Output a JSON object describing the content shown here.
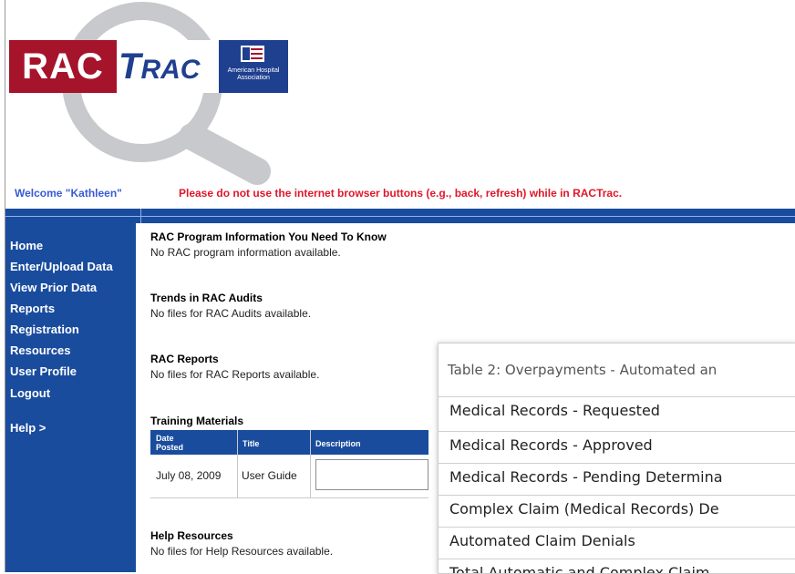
{
  "header": {
    "logo": {
      "rac": "RAC",
      "trac_first": "T",
      "trac_rest": "RAC",
      "aha_text": "American Hospital Association"
    },
    "welcome": "Welcome \"Kathleen\"",
    "warning": "Please do not use the internet browser buttons (e.g., back, refresh) while in RACTrac."
  },
  "sidebar": {
    "items": [
      {
        "label": "Home"
      },
      {
        "label": "Enter/Upload Data"
      },
      {
        "label": "View Prior Data"
      },
      {
        "label": "Reports"
      },
      {
        "label": "Registration"
      },
      {
        "label": "Resources"
      },
      {
        "label": "User Profile"
      },
      {
        "label": "Logout"
      },
      {
        "label": "Help >"
      }
    ]
  },
  "main": {
    "sections": [
      {
        "title": "RAC Program Information You Need To Know",
        "text": "No RAC program information available."
      },
      {
        "title": "Trends in RAC Audits",
        "text": "No files for RAC Audits available."
      },
      {
        "title": "RAC Reports",
        "text": "No files for RAC Reports available."
      },
      {
        "title": "Training Materials"
      },
      {
        "title": "Help Resources",
        "text": "No files for Help Resources available."
      }
    ],
    "training_table": {
      "headers": {
        "date": "Date\nPosted",
        "date_line1": "Date",
        "date_line2": "Posted",
        "title": "Title",
        "description": "Description"
      },
      "rows": [
        {
          "date": "July 08, 2009",
          "title": "User Guide",
          "description": ""
        }
      ]
    }
  },
  "overlay": {
    "title": "Table 2: Overpayments - Automated an",
    "rows": [
      "Medical Records - Requested",
      "Medical Records - Approved",
      "Medical Records - Pending Determina",
      "Complex Claim (Medical Records) De",
      "Automated Claim Denials",
      "Total Automatic and Complex Claim"
    ]
  },
  "colors": {
    "brand_blue": "#1a4c9e",
    "brand_red": "#a5142b",
    "welcome_blue": "#3a5ad6",
    "warning_red": "#e0172a"
  }
}
